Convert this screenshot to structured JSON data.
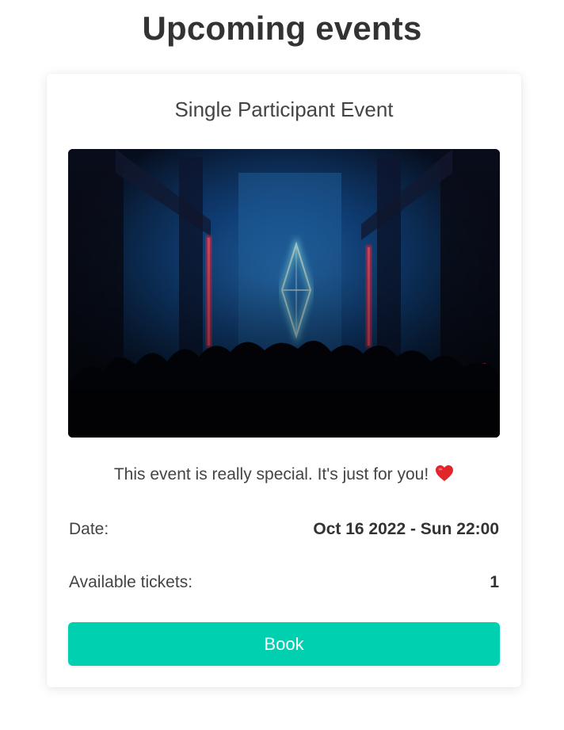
{
  "page": {
    "title": "Upcoming events"
  },
  "event": {
    "title": "Single Participant Event",
    "image_alt": "Concert stage with neon diamond light and silhouetted crowd",
    "description": "This event is really special. It's just for you!",
    "description_icon": "red-heart-icon",
    "date_label": "Date:",
    "date_value": "Oct 16 2022 - Sun 22:00",
    "tickets_label": "Available tickets:",
    "tickets_value": "1",
    "book_label": "Book"
  },
  "colors": {
    "accent": "#00d0b0",
    "heart": "#e0262b",
    "text": "#444444"
  }
}
